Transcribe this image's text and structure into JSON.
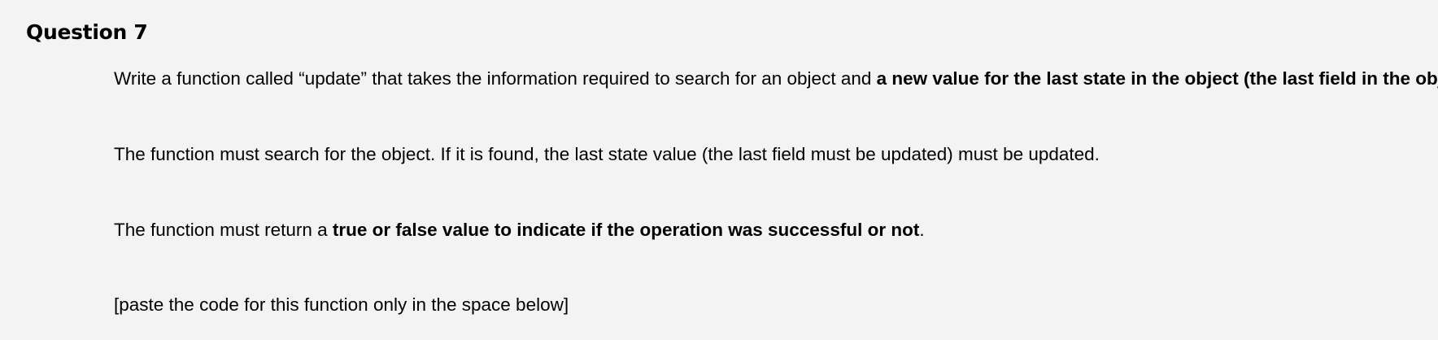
{
  "question": {
    "title": "Question 7",
    "paragraphs": [
      {
        "text_before": "Write a function called “update” that takes the information required to search for an object and ",
        "bold": "a new value for the last state in the object (the last field in the object)",
        "text_after": "."
      },
      {
        "text": "The function must search for the object. If it is found, the last state value (the last field must be updated) must be updated."
      },
      {
        "text_before": "The function must return a ",
        "bold": "true or false value to indicate if the operation was successful or not",
        "text_after": "."
      },
      {
        "text": "[paste the code for this function only in the space below]"
      }
    ]
  }
}
